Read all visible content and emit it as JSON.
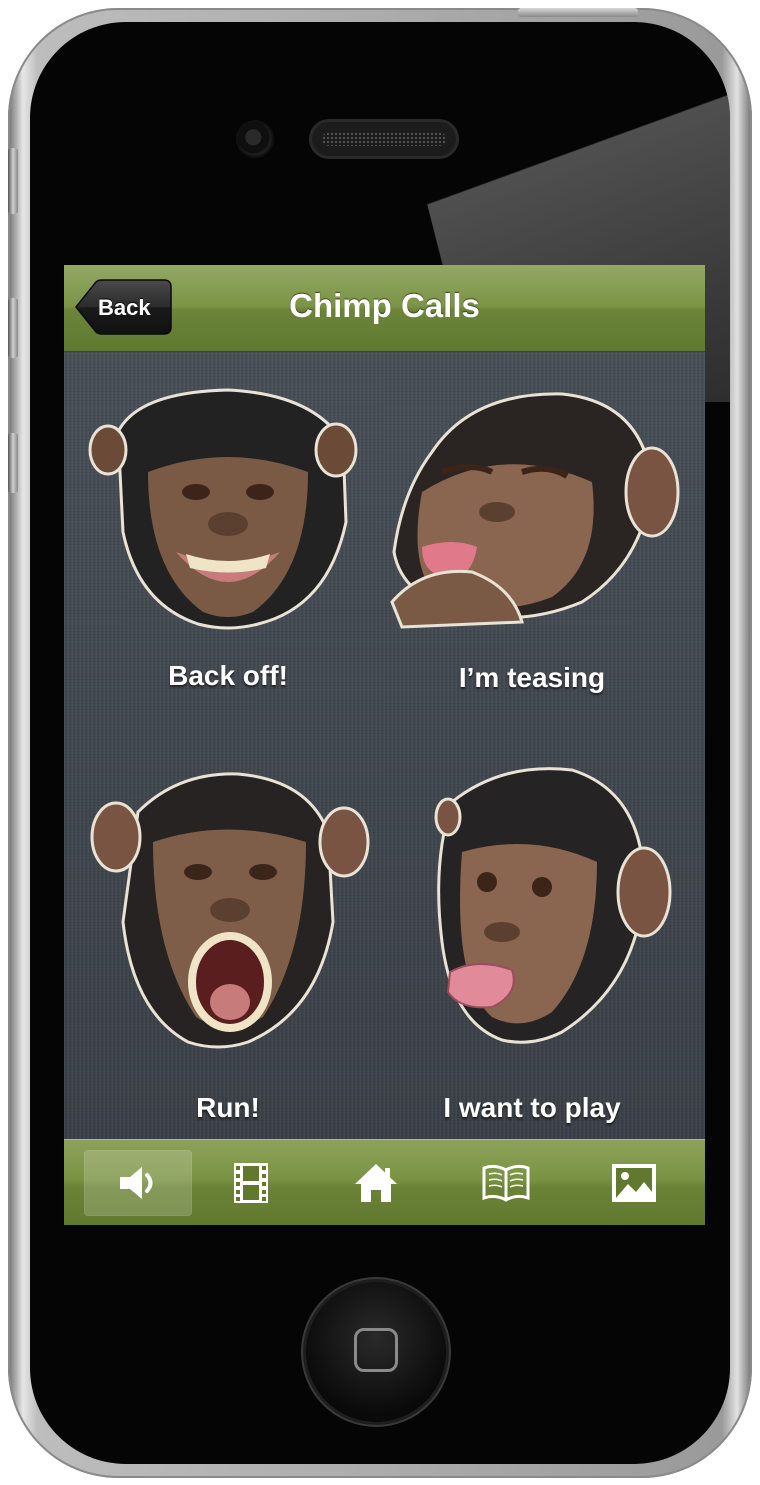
{
  "navbar": {
    "back_label": "Back",
    "title": "Chimp Calls"
  },
  "calls": [
    {
      "label": "Back off!",
      "icon": "chimp-grin-face"
    },
    {
      "label": "I’m teasing",
      "icon": "chimp-tongue-face"
    },
    {
      "label": "Run!",
      "icon": "chimp-scream-face"
    },
    {
      "label": "I want to play",
      "icon": "chimp-pout-face"
    }
  ],
  "tabs": [
    {
      "icon": "speaker-icon",
      "active": true
    },
    {
      "icon": "film-icon",
      "active": false
    },
    {
      "icon": "home-icon",
      "active": false
    },
    {
      "icon": "book-icon",
      "active": false
    },
    {
      "icon": "picture-icon",
      "active": false
    }
  ],
  "colors": {
    "bar_green": "#7b9447",
    "content_background": "#41474f"
  }
}
